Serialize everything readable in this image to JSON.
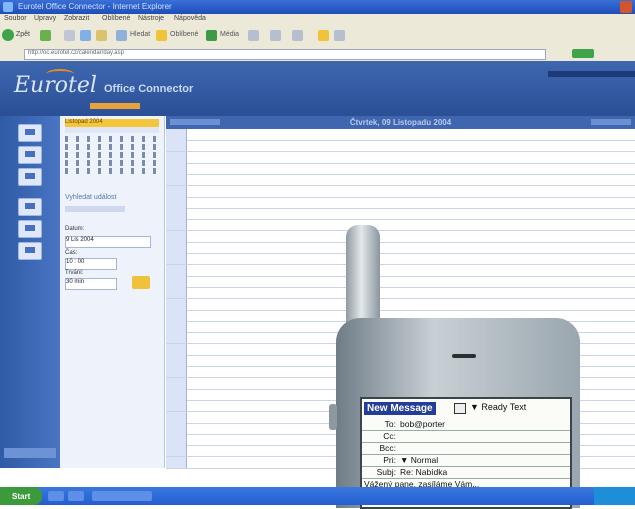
{
  "window": {
    "title": "Eurotel Office Connector - Internet Explorer"
  },
  "menubar": {
    "items": [
      "Soubor",
      "Úpravy",
      "Zobrazit",
      "Oblíbené",
      "Nástroje",
      "Nápověda"
    ]
  },
  "toolbar": {
    "back_label": "Zpět",
    "search_label": "Hledat",
    "favorites_label": "Oblíbené",
    "media_label": "Média"
  },
  "addressbar": {
    "url": "http://oc.eurotel.cz/calendar/day.asp",
    "go_label": "Přejít"
  },
  "app": {
    "brand": "Eurotel",
    "product": "Office Connector"
  },
  "calendar": {
    "title": "Čtvrtek, 09 Listopadu 2004",
    "mini_header": "Listopad 2004",
    "search_label": "Vyhledat událost",
    "date_label": "Datum:",
    "date_value": "9  Lis  2004",
    "time_label": "Čas:",
    "time_value": "10 : 00",
    "duration_label": "Trvání:",
    "duration_value": "30 min"
  },
  "message": {
    "title": "New Message",
    "mode": "▼ Ready Text",
    "to_label": "To:",
    "to_value": "bob@porter",
    "cc_label": "Cc:",
    "cc_value": "",
    "bcc_label": "Bcc:",
    "bcc_value": "",
    "pri_label": "Pri:",
    "pri_value": "▼ Normal",
    "subj_label": "Subj:",
    "subj_value": "Re: Nabídka",
    "body": "Vážený pane, zasíláme Vám..."
  },
  "taskbar": {
    "start_label": "Start"
  }
}
